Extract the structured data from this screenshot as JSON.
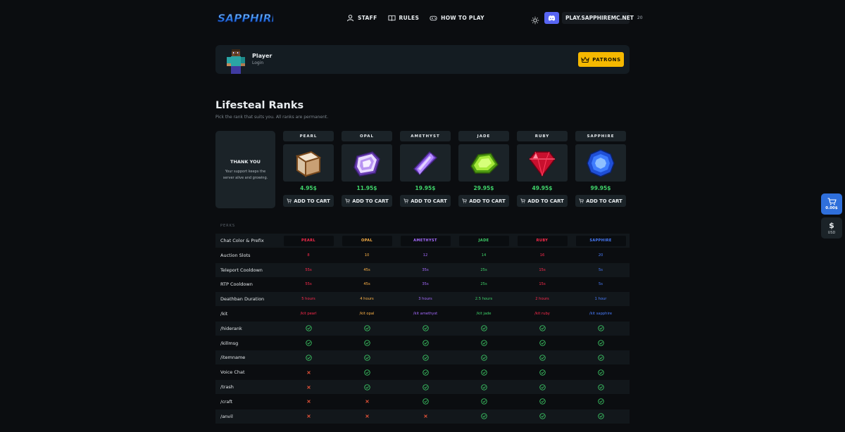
{
  "brand": {
    "logo_text": "SAPPHIRE"
  },
  "nav": [
    {
      "label": "STAFF",
      "icon": "staff-icon"
    },
    {
      "label": "RULES",
      "icon": "book-icon"
    },
    {
      "label": "HOW TO PLAY",
      "icon": "gamepad-icon"
    }
  ],
  "server": {
    "ip": "PLAY.SAPPHIREMC.NET",
    "player_count": "20"
  },
  "player": {
    "name": "Player",
    "action": "Login"
  },
  "patrons_label": "PATRONS",
  "page": {
    "title": "Lifesteal Ranks",
    "subtitle": "Pick the rank that suits you. All ranks are permanent."
  },
  "thanks": {
    "title": "THANK YOU",
    "text": "Your support keeps the server alive and growing."
  },
  "ranks": [
    {
      "label": "PEARL",
      "price": "4.95$",
      "button": "ADD TO CART",
      "color": "#ff2a4d"
    },
    {
      "label": "OPAL",
      "price": "11.95$",
      "button": "ADD TO CART",
      "color": "#ffb347"
    },
    {
      "label": "AMETHYST",
      "price": "19.95$",
      "button": "ADD TO CART",
      "color": "#a66bff"
    },
    {
      "label": "JADE",
      "price": "29.95$",
      "button": "ADD TO CART",
      "color": "#3fd46a"
    },
    {
      "label": "RUBY",
      "price": "49.95$",
      "button": "ADD TO CART",
      "color": "#ff2a4d"
    },
    {
      "label": "SAPPHIRE",
      "price": "99.95$",
      "button": "ADD TO CART",
      "color": "#4a7dff"
    }
  ],
  "perks": {
    "heading": "PERKS",
    "rows": [
      {
        "label": "Chat Color & Prefix",
        "type": "tag",
        "values": [
          "PEARL",
          "OPAL",
          "AMETHYST",
          "JADE",
          "RUBY",
          "SAPPHIRE"
        ]
      },
      {
        "label": "Auction Slots",
        "type": "text",
        "values": [
          "8",
          "10",
          "12",
          "14",
          "16",
          "20"
        ]
      },
      {
        "label": "Teleport Cooldown",
        "type": "text",
        "values": [
          "55s",
          "45s",
          "35s",
          "25s",
          "15s",
          "5s"
        ]
      },
      {
        "label": "RTP Cooldown",
        "type": "text",
        "values": [
          "55s",
          "45s",
          "35s",
          "25s",
          "15s",
          "5s"
        ]
      },
      {
        "label": "Deathban Duration",
        "type": "text",
        "values": [
          "5 hours",
          "4 hours",
          "3 hours",
          "2.5 hours",
          "2 hours",
          "1 hour"
        ]
      },
      {
        "label": "/kit",
        "type": "text",
        "values": [
          "/kit pearl",
          "/kit opal",
          "/kit amethyst",
          "/kit jade",
          "/kit ruby",
          "/kit sapphire"
        ]
      },
      {
        "label": "/hiderank",
        "type": "bool",
        "values": [
          true,
          true,
          true,
          true,
          true,
          true
        ]
      },
      {
        "label": "/killmsg",
        "type": "bool",
        "values": [
          true,
          true,
          true,
          true,
          true,
          true
        ]
      },
      {
        "label": "/itemname",
        "type": "bool",
        "values": [
          true,
          true,
          true,
          true,
          true,
          true
        ]
      },
      {
        "label": "Voice Chat",
        "type": "bool",
        "values": [
          false,
          true,
          true,
          true,
          true,
          true
        ]
      },
      {
        "label": "/trash",
        "type": "bool",
        "values": [
          false,
          true,
          true,
          true,
          true,
          true
        ]
      },
      {
        "label": "/craft",
        "type": "bool",
        "values": [
          false,
          false,
          true,
          true,
          true,
          true
        ]
      },
      {
        "label": "/anvil",
        "type": "bool",
        "values": [
          false,
          false,
          false,
          true,
          true,
          true
        ]
      }
    ]
  },
  "cart": {
    "total": "0.00$"
  },
  "currency": {
    "symbol": "$",
    "code": "USD"
  },
  "colors": {
    "accent": "#2f6fdb",
    "discord": "#5865f2",
    "patrons": "#f5b800",
    "price": "#3fd46a",
    "check": "#3fd46a",
    "cross": "#ff5a3c"
  }
}
